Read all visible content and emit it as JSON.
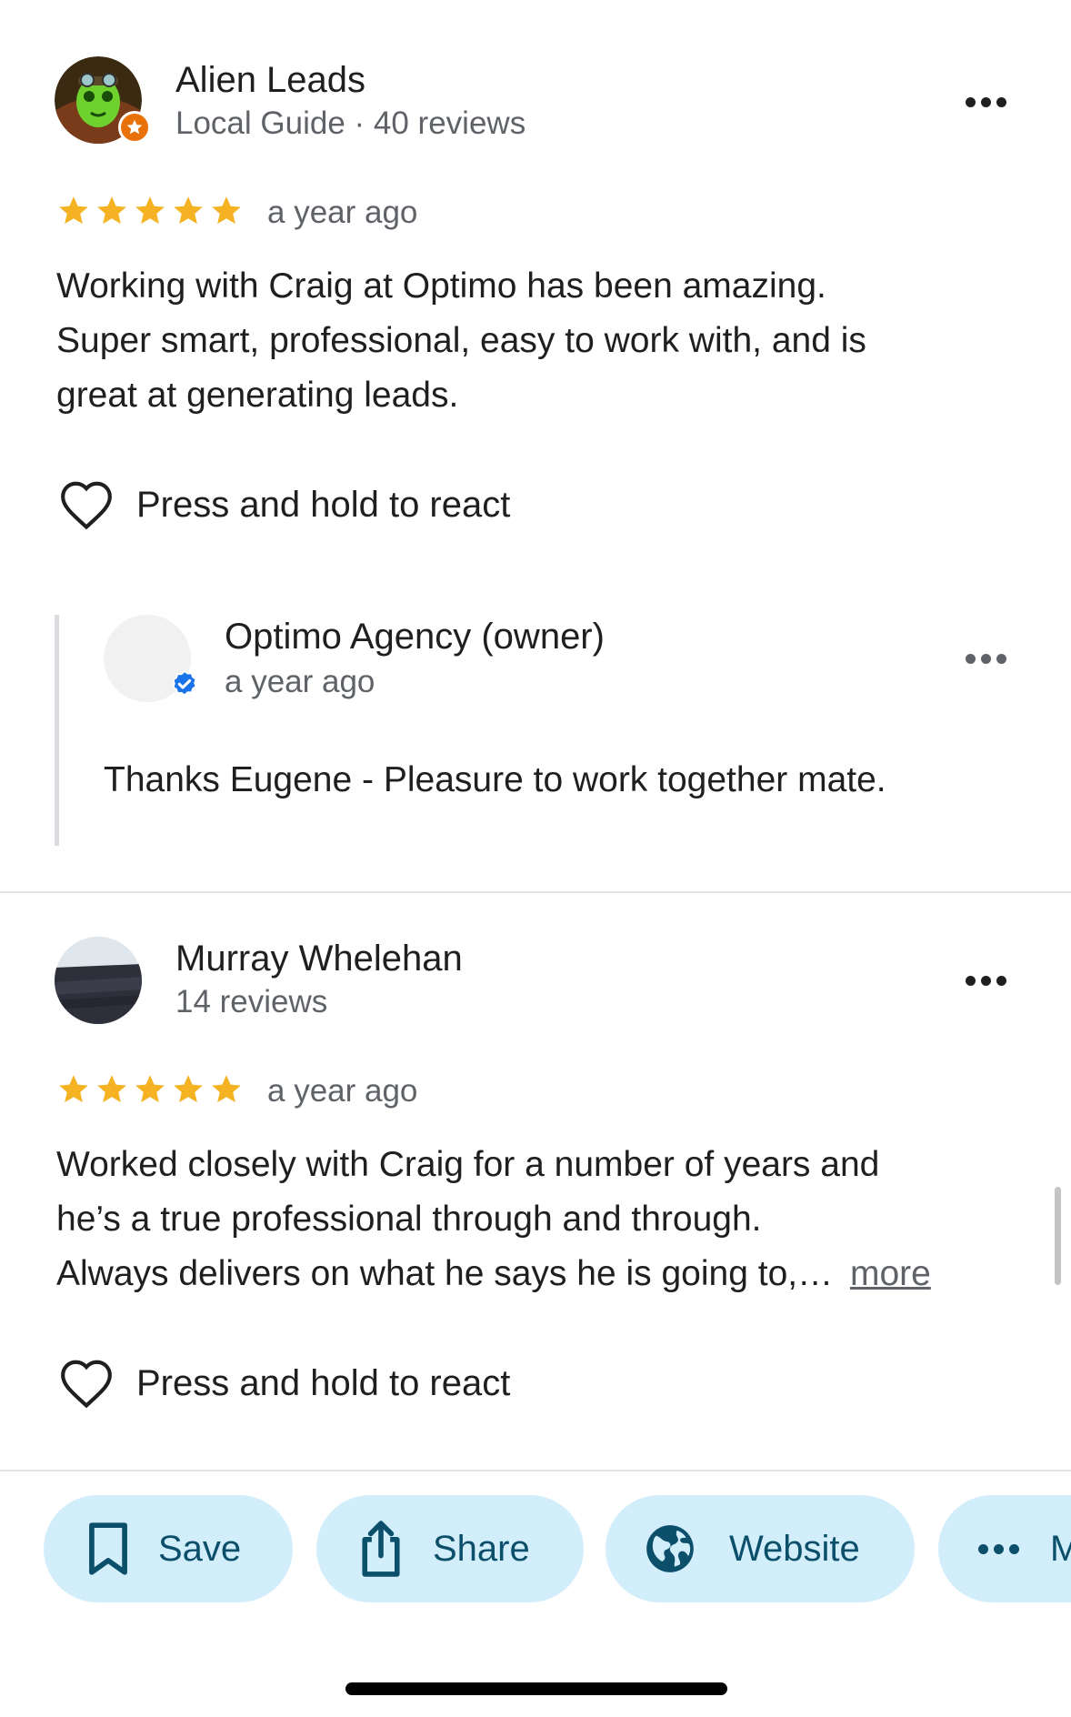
{
  "reviews": [
    {
      "name": "Alien Leads",
      "meta": "Local Guide · 40 reviews",
      "rating": 5,
      "time": "a year ago",
      "text_lines": [
        "Working with Craig at Optimo has been amazing.",
        "Super smart, professional, easy to work with, and is",
        "great at generating leads."
      ],
      "react_label": "Press and hold to react",
      "owner_reply": {
        "name": "Optimo Agency (owner)",
        "time": "a year ago",
        "text": "Thanks Eugene - Pleasure to work together mate."
      }
    },
    {
      "name": "Murray Whelehan",
      "meta": "14 reviews",
      "rating": 5,
      "time": "a year ago",
      "text_lines": [
        "Worked closely with Craig for a number of years and",
        "he’s a true professional through and through.",
        "Always delivers on what he says he is going to,…"
      ],
      "more_label": "more",
      "react_label": "Press and hold to react"
    }
  ],
  "actions": {
    "save_label": "Save",
    "share_label": "Share",
    "website_label": "Website",
    "overflow_label": "M"
  },
  "colors": {
    "star": "#f5b324",
    "chip_bg": "#d3eefb",
    "chip_text": "#0b4f6b",
    "verified": "#1a73e8",
    "local_guide_badge": "#e8710a"
  },
  "icons": [
    "ellipsis-icon",
    "star-icon",
    "heart-outline-icon",
    "verified-check-icon",
    "local-guide-star-icon",
    "bookmark-icon",
    "share-icon",
    "globe-icon"
  ]
}
